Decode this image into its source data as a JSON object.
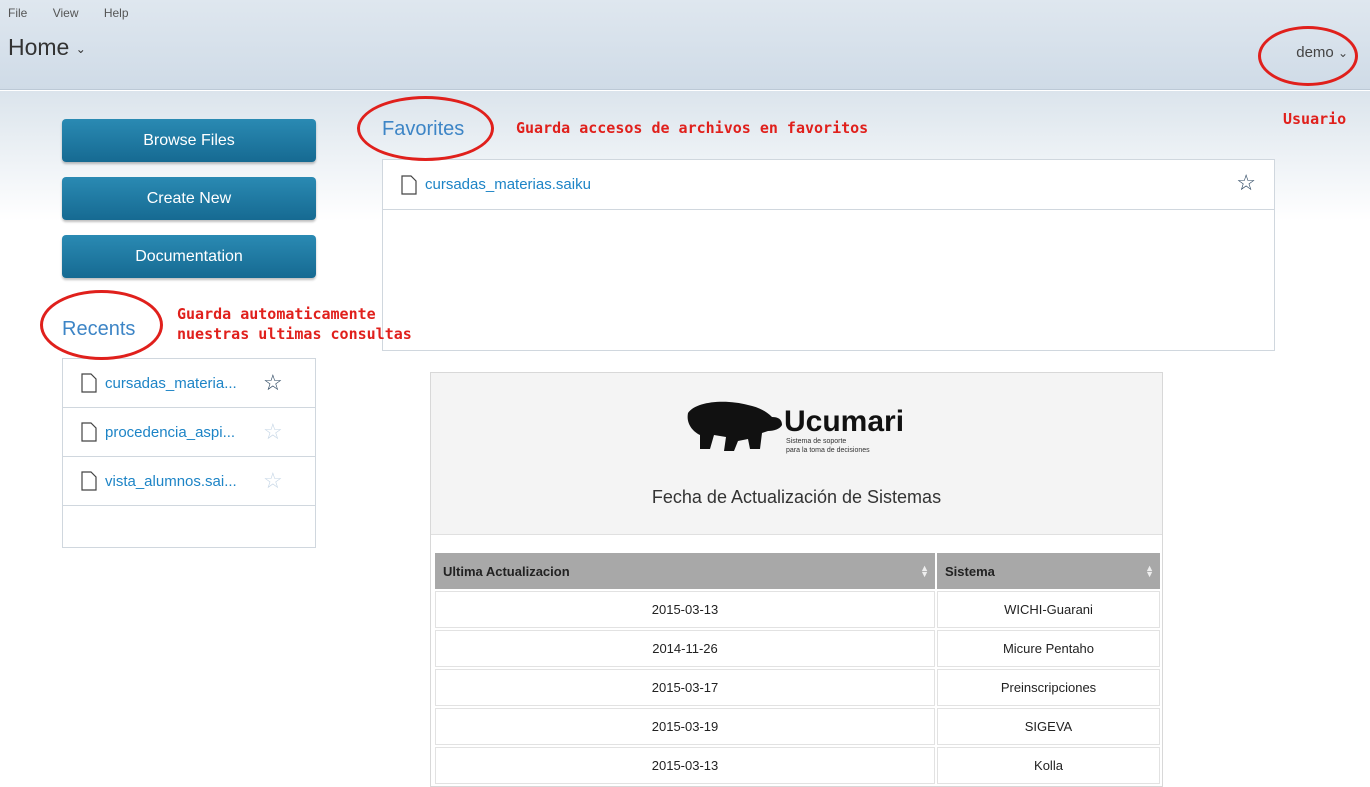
{
  "menu": {
    "items": [
      "File",
      "View",
      "Help"
    ]
  },
  "header": {
    "title": "Home",
    "user": "demo"
  },
  "sidebar": {
    "buttons": [
      "Browse Files",
      "Create New",
      "Documentation"
    ],
    "recents_title": "Recents",
    "recents": [
      {
        "label": "cursadas_materia...",
        "starred": true
      },
      {
        "label": "procedencia_aspi...",
        "starred": false
      },
      {
        "label": "vista_alumnos.sai...",
        "starred": false
      }
    ]
  },
  "favorites": {
    "title": "Favorites",
    "items": [
      {
        "label": "cursadas_materias.saiku",
        "starred": true
      }
    ]
  },
  "annotations": {
    "favorites": "Guarda accesos de archivos en favoritos",
    "user": "Usuario",
    "recents_line1": "Guarda automaticamente",
    "recents_line2": "nuestras ultimas consultas"
  },
  "report": {
    "logo_name": "Ucumari",
    "logo_sub1": "Sistema de soporte",
    "logo_sub2": "para la toma de decisiones",
    "title": "Fecha de Actualización de Sistemas",
    "columns": [
      "Ultima Actualizacion",
      "Sistema"
    ],
    "rows": [
      [
        "2015-03-13",
        "WICHI-Guarani"
      ],
      [
        "2014-11-26",
        "Micure Pentaho"
      ],
      [
        "2015-03-17",
        "Preinscripciones"
      ],
      [
        "2015-03-19",
        "SIGEVA"
      ],
      [
        "2015-03-13",
        "Kolla"
      ]
    ]
  },
  "colors": {
    "button": "#1e7aa3",
    "link": "#1d84c6",
    "annotation": "#e0201c"
  },
  "icons": {
    "file": "file-icon",
    "star": "star-icon",
    "chevron": "chevron-down-icon",
    "logo": "bear-logo-icon"
  }
}
